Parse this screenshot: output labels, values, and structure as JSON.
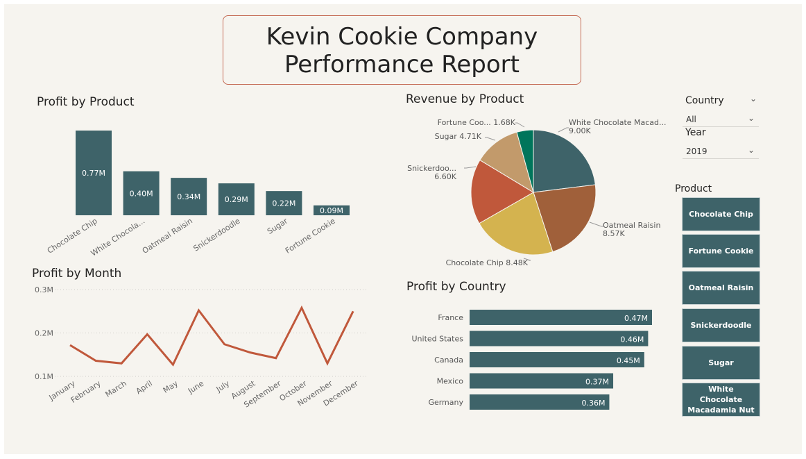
{
  "report_title": {
    "line1": "Kevin Cookie Company",
    "line2": "Performance Report"
  },
  "colors": {
    "teal": "#3e6369",
    "rust": "#c0583b",
    "tan": "#c29a6b",
    "brown": "#a0603a",
    "gold": "#d4b34f",
    "green": "#00755b",
    "background": "#f6f4ef"
  },
  "filters": {
    "country": {
      "label": "Country",
      "value": "All"
    },
    "year": {
      "label": "Year",
      "value": "2019"
    },
    "product_label": "Product",
    "products": [
      "Chocolate Chip",
      "Fortune Cookie",
      "Oatmeal Raisin",
      "Snickerdoodle",
      "Sugar",
      "White Chocolate Macadamia Nut"
    ]
  },
  "chart_data": [
    {
      "type": "bar",
      "title": "Profit by Product",
      "categories": [
        "Chocolate Chip",
        "White Chocola...",
        "Oatmeal Raisin",
        "Snickerdoodle",
        "Sugar",
        "Fortune Cookie"
      ],
      "values": [
        0.77,
        0.4,
        0.34,
        0.29,
        0.22,
        0.09
      ],
      "data_labels": [
        "0.77M",
        "0.40M",
        "0.34M",
        "0.29M",
        "0.22M",
        "0.09M"
      ],
      "unit": "M"
    },
    {
      "type": "pie",
      "title": "Revenue by Product",
      "slices": [
        {
          "name": "White Chocolate Macad...",
          "value": 9.0,
          "label": "9.00K",
          "color": "#3e6369"
        },
        {
          "name": "Oatmeal Raisin",
          "value": 8.57,
          "label": "8.57K",
          "color": "#a0603a"
        },
        {
          "name": "Chocolate Chip",
          "value": 8.48,
          "label": "8.48K",
          "color": "#d4b34f"
        },
        {
          "name": "Snickerdoo...",
          "value": 6.6,
          "label": "6.60K",
          "color": "#c0583b"
        },
        {
          "name": "Sugar",
          "value": 4.71,
          "label": "4.71K",
          "color": "#c29a6b"
        },
        {
          "name": "Fortune Coo...",
          "value": 1.68,
          "label": "1.68K",
          "color": "#00755b"
        }
      ]
    },
    {
      "type": "line",
      "title": "Profit by Month",
      "x": [
        "January",
        "February",
        "March",
        "April",
        "May",
        "June",
        "July",
        "August",
        "September",
        "October",
        "November",
        "December"
      ],
      "values": [
        0.172,
        0.136,
        0.13,
        0.197,
        0.127,
        0.252,
        0.174,
        0.155,
        0.142,
        0.258,
        0.13,
        0.25
      ],
      "yticks": [
        "0.3M",
        "0.2M",
        "0.1M"
      ],
      "ylim": [
        0.1,
        0.3
      ]
    },
    {
      "type": "bar",
      "orientation": "horizontal",
      "title": "Profit by Country",
      "categories": [
        "France",
        "United States",
        "Canada",
        "Mexico",
        "Germany"
      ],
      "values": [
        0.47,
        0.46,
        0.45,
        0.37,
        0.36
      ],
      "data_labels": [
        "0.47M",
        "0.46M",
        "0.45M",
        "0.37M",
        "0.36M"
      ]
    }
  ]
}
